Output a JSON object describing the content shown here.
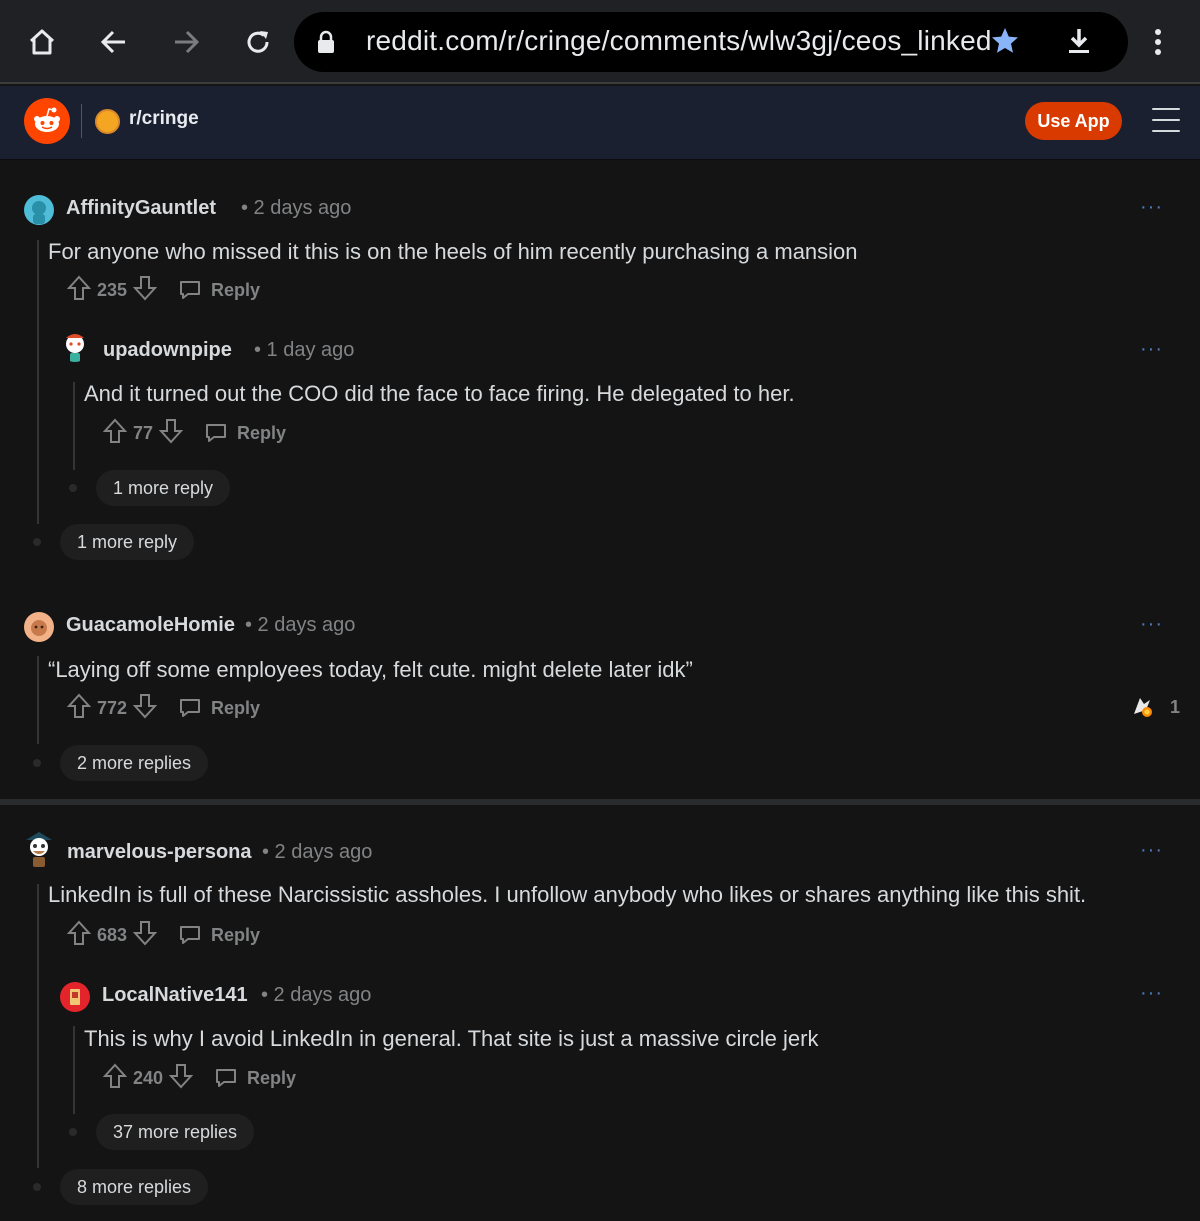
{
  "browser": {
    "url": "reddit.com/r/cringe/comments/wlw3gj/ceos_linked"
  },
  "header": {
    "subreddit": "r/cringe",
    "use_app": "Use App"
  },
  "comments": [
    {
      "user": "AffinityGauntlet",
      "time": "• 2 days ago",
      "text": "For anyone who missed it this is on the heels of him recently purchasing a mansion",
      "votes": "235",
      "reply": "Reply",
      "more": "1 more reply",
      "child": {
        "user": "upadownpipe",
        "time": "• 1 day ago",
        "text": "And it turned out the COO did the face to face firing. He delegated to her.",
        "votes": "77",
        "reply": "Reply",
        "more": "1 more reply"
      }
    },
    {
      "user": "GuacamoleHomie",
      "time": "• 2 days ago",
      "text": "“Laying off some employees today, felt cute. might delete later idk”",
      "votes": "772",
      "reply": "Reply",
      "award_count": "1",
      "more": "2 more replies"
    },
    {
      "user": "marvelous-persona",
      "time": "• 2 days ago",
      "text": "LinkedIn is full of these Narcissistic assholes. I unfollow anybody who likes or shares anything like this shit.",
      "votes": "683",
      "reply": "Reply",
      "more": "8 more replies",
      "child": {
        "user": "LocalNative141",
        "time": "• 2 days ago",
        "text": "This is why I avoid LinkedIn in general. That site is just a massive circle jerk",
        "votes": "240",
        "reply": "Reply",
        "more": "37 more replies"
      }
    }
  ],
  "more_menu": "···",
  "colors": {
    "accent": "#ff4500",
    "use_app_bg": "#d93a00",
    "star": "#8ab4f8",
    "background": "#141415"
  }
}
